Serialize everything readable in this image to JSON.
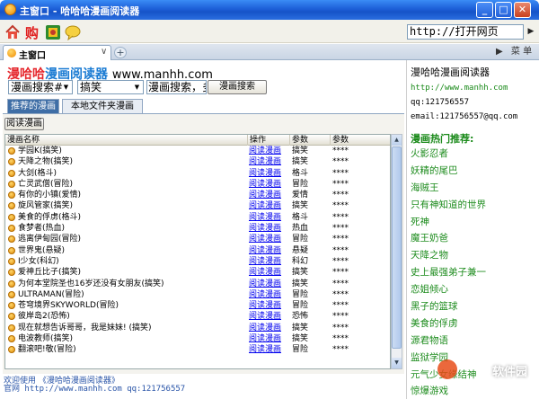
{
  "window": {
    "title": "主窗口 - 哈哈哈漫画阅读器"
  },
  "toolbar": {
    "icons": [
      "home-icon",
      "buy-icon",
      "plugin-icon",
      "chat-icon"
    ],
    "url_value": "http://打开网页"
  },
  "tabs": {
    "main_label": "主窗口",
    "menu_label": "菜 单"
  },
  "brand": {
    "part1": "漫哈哈",
    "part2": "漫画阅读器",
    "site": "www.manhh.com"
  },
  "search": {
    "type_value": "漫画搜索#",
    "genre_value": "搞笑",
    "query_value": "漫画搜索，多",
    "button_label": "漫画搜索"
  },
  "left_tabs": [
    "推荐的漫画",
    "本地文件夹漫画"
  ],
  "read_button": "阅读漫画",
  "table": {
    "headers": [
      "漫画名称",
      "操作",
      "参数",
      "参数"
    ],
    "rows": [
      {
        "name": "学园K(搞笑)",
        "action": "阅读漫画",
        "genre": "搞笑",
        "stars": "****"
      },
      {
        "name": "天降之物(搞笑)",
        "action": "阅读漫画",
        "genre": "搞笑",
        "stars": "****"
      },
      {
        "name": "大剑(格斗)",
        "action": "阅读漫画",
        "genre": "格斗",
        "stars": "****"
      },
      {
        "name": "亡灵武僧(冒险)",
        "action": "阅读漫画",
        "genre": "冒险",
        "stars": "****"
      },
      {
        "name": "有你的小镇(爱情)",
        "action": "阅读漫画",
        "genre": "爱情",
        "stars": "****"
      },
      {
        "name": "旋风管家(搞笑)",
        "action": "阅读漫画",
        "genre": "搞笑",
        "stars": "****"
      },
      {
        "name": "美食的俘虏(格斗)",
        "action": "阅读漫画",
        "genre": "格斗",
        "stars": "****"
      },
      {
        "name": "食梦者(热血)",
        "action": "阅读漫画",
        "genre": "热血",
        "stars": "****"
      },
      {
        "name": "逃离伊甸园(冒险)",
        "action": "阅读漫画",
        "genre": "冒险",
        "stars": "****"
      },
      {
        "name": "世界鬼(悬疑)",
        "action": "阅读漫画",
        "genre": "悬疑",
        "stars": "****"
      },
      {
        "name": "I少女(科幻)",
        "action": "阅读漫画",
        "genre": "科幻",
        "stars": "****"
      },
      {
        "name": "爱神丘比子(搞笑)",
        "action": "阅读漫画",
        "genre": "搞笑",
        "stars": "****"
      },
      {
        "name": "为何本堂院圣也16岁还没有女朋友(搞笑)",
        "action": "阅读漫画",
        "genre": "搞笑",
        "stars": "****"
      },
      {
        "name": "ULTRAMAN(冒险)",
        "action": "阅读漫画",
        "genre": "冒险",
        "stars": "****"
      },
      {
        "name": "苍穹境界SKYWORLD(冒险)",
        "action": "阅读漫画",
        "genre": "冒险",
        "stars": "****"
      },
      {
        "name": "彼岸岛2(恐怖)",
        "action": "阅读漫画",
        "genre": "恐怖",
        "stars": "****"
      },
      {
        "name": "现在就想告诉哥哥，我是妹妹! (搞笑)",
        "action": "阅读漫画",
        "genre": "搞笑",
        "stars": "****"
      },
      {
        "name": "电波教师(搞笑)",
        "action": "阅读漫画",
        "genre": "搞笑",
        "stars": "****"
      },
      {
        "name": "翻滚吧!敬(冒险)",
        "action": "阅读漫画",
        "genre": "冒险",
        "stars": "****"
      }
    ]
  },
  "status": {
    "line1": "欢迎使用 《漫哈哈漫画阅读器》",
    "line2": "官网 http://www.manhh.com qq:121756557"
  },
  "right": {
    "title": "漫哈哈漫画阅读器",
    "url": "http://www.manhh.com",
    "qq": "qq:121756557",
    "email": "email:121756557@qq.com",
    "hot_title": "漫画热门推荐:",
    "hot": [
      "火影忍者",
      "妖精的尾巴",
      "海贼王",
      "只有神知道的世界",
      "死神",
      "魔王奶爸",
      "天降之物",
      "史上最强弟子兼一",
      "恋姐倾心",
      "黑子的篮球",
      "美食的俘虏",
      "源君物语",
      "监狱学园",
      "元气少女缘结神",
      "惊爆游戏"
    ]
  },
  "watermark": "软件园"
}
